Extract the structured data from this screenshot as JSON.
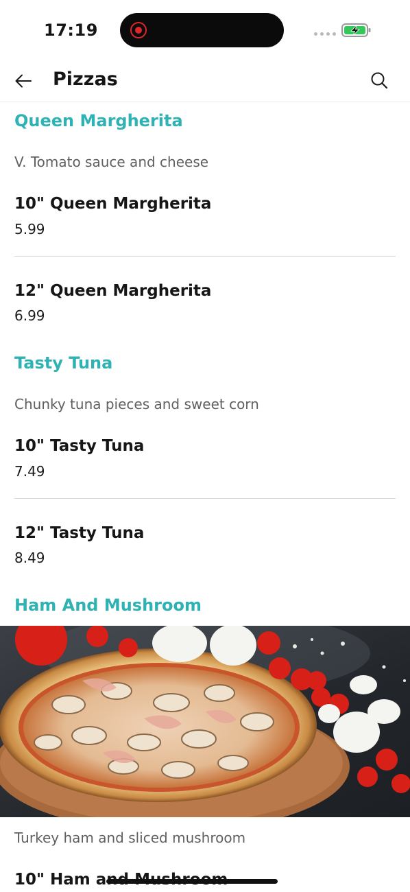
{
  "status_bar": {
    "time": "17:19",
    "recording_indicator_color": "#e0262b",
    "battery_icon": "battery-charging-icon",
    "battery_color": "#34c759"
  },
  "header": {
    "title": "Pizzas",
    "back_icon": "arrow-left-icon",
    "search_icon": "search-icon"
  },
  "colors": {
    "accent": "#2fb2b4",
    "text": "#161616",
    "muted": "#5f5f5f"
  },
  "categories": [
    {
      "title": "Queen Margherita",
      "description": "V. Tomato sauce and cheese",
      "items": [
        {
          "name": "10\" Queen Margherita",
          "price": "5.99"
        },
        {
          "name": "12\" Queen Margherita",
          "price": "6.99"
        }
      ]
    },
    {
      "title": "Tasty Tuna",
      "description": "Chunky tuna pieces and sweet corn",
      "items": [
        {
          "name": "10\" Tasty Tuna",
          "price": "7.49"
        },
        {
          "name": "12\" Tasty Tuna",
          "price": "8.49"
        }
      ]
    },
    {
      "title": "Ham And Mushroom",
      "description": "Turkey ham and sliced mushroom",
      "has_image": true,
      "items": [
        {
          "name": "10\" Ham and Mushroom",
          "price": ""
        }
      ]
    }
  ]
}
